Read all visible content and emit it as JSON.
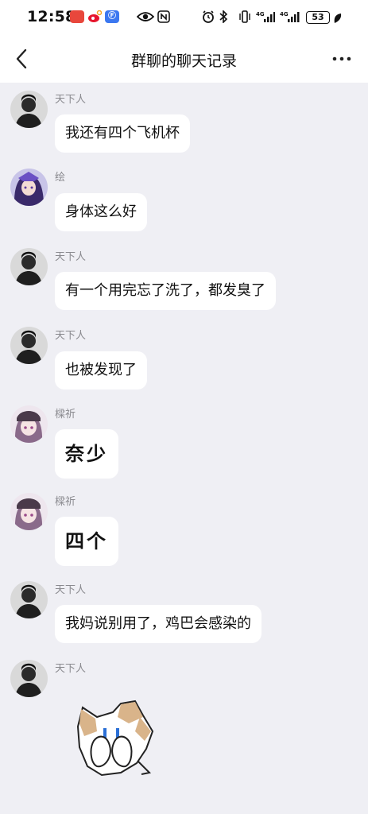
{
  "status_bar": {
    "time": "12:58",
    "battery": "53"
  },
  "header": {
    "title": "群聊的聊天记录"
  },
  "messages": [
    {
      "sender": "天下人",
      "text": "我还有四个飞机杯"
    },
    {
      "sender": "绘",
      "text": "身体这么好"
    },
    {
      "sender": "天下人",
      "text": "有一个用完忘了洗了，都发臭了"
    },
    {
      "sender": "天下人",
      "text": "也被发现了"
    },
    {
      "sender": "樑祈",
      "text": "奈少"
    },
    {
      "sender": "樑祈",
      "text": "四个"
    },
    {
      "sender": "天下人",
      "text": "我妈说别用了，鸡巴会感染的"
    },
    {
      "sender": "天下人",
      "sticker": "crying-cat-sticker"
    }
  ],
  "icons": {
    "back": "chevron-left-icon",
    "more": "more-dots-icon"
  },
  "colors": {
    "background": "#efeff4",
    "bubble": "#ffffff",
    "sender_text": "#8a8a8f"
  }
}
